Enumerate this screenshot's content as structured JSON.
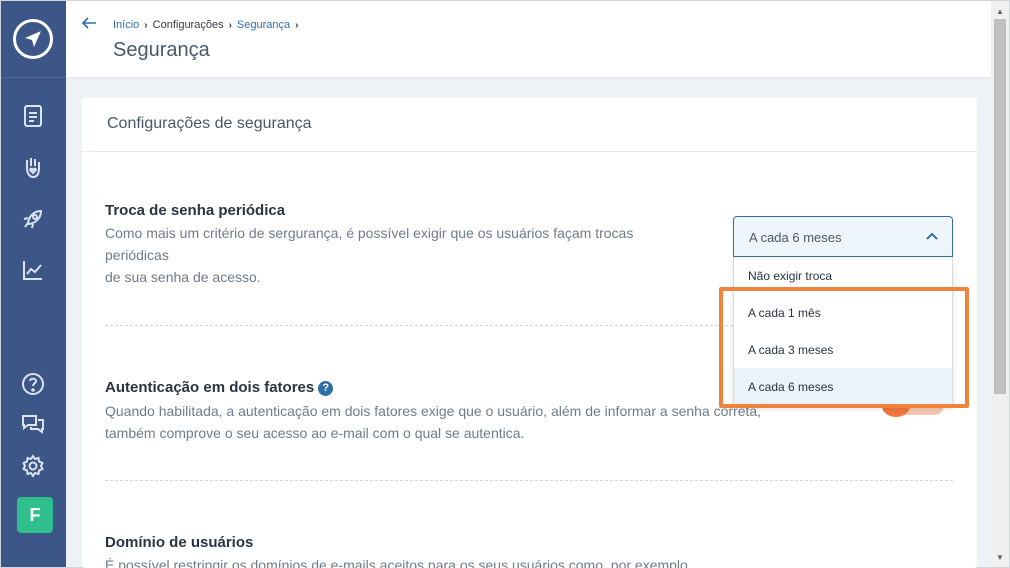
{
  "breadcrumb": {
    "home": "Início",
    "settings": "Configurações",
    "current": "Segurança"
  },
  "header": {
    "title": "Segurança"
  },
  "card": {
    "title": "Configurações de segurança"
  },
  "password_rotation": {
    "title": "Troca de senha periódica",
    "line1": "Como mais um critério de sergurança, é possível exigir que os usuários façam trocas",
    "line2": "periódicas",
    "line3": "de sua senha de acesso.",
    "select_value": "A cada 6 meses",
    "options": [
      "Não exigir troca",
      "A cada 1 mês",
      "A cada 3 meses",
      "A cada 6 meses"
    ],
    "selected_index": 3
  },
  "two_factor": {
    "title": "Autenticação em dois fatores",
    "help": "?",
    "line1": "Quando habilitada, a autenticação em dois fatores exige que o usuário, além de informar a senha correta,",
    "line2": "também comprove o seu acesso ao e-mail com o qual se autentica."
  },
  "domain": {
    "title": "Domínio de usuários",
    "line1": "É possível restringir os domínios de e-mails aceitos para os seus usuários como, por exemplo"
  },
  "user": {
    "avatar_letter": "F"
  },
  "icons": {
    "logo": "paper-plane-logo-icon",
    "nav": [
      "document-icon",
      "hand-heart-icon",
      "rocket-icon",
      "chart-icon",
      "help-circle-icon",
      "chat-icon",
      "gear-icon"
    ]
  },
  "colors": {
    "sidebar": "#3b5687",
    "link": "#2f6fa8",
    "accent": "#f0823c",
    "avatar": "#2fbf8d"
  }
}
